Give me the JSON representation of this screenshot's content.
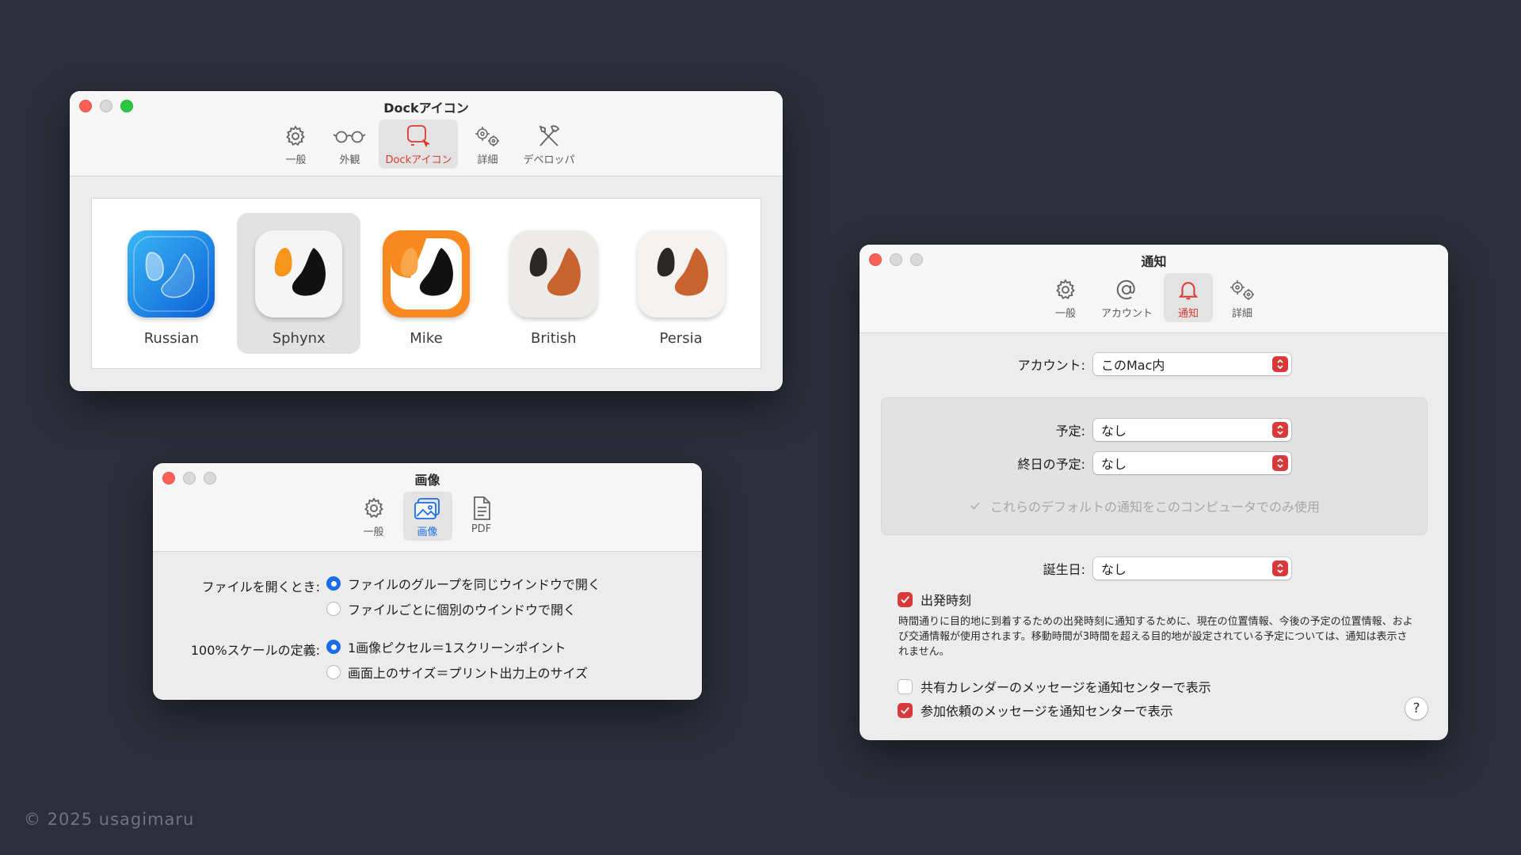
{
  "colors": {
    "background": "#2c2f3b",
    "accent_red": "#d8393a",
    "accent_blue": "#1a6ee8"
  },
  "dock_window": {
    "title": "Dockアイコン",
    "tabs": [
      {
        "label": "一般",
        "icon": "gear-icon"
      },
      {
        "label": "外観",
        "icon": "glasses-icon"
      },
      {
        "label": "Dockアイコン",
        "icon": "dock-icon-icon",
        "active": true
      },
      {
        "label": "詳細",
        "icon": "gears-icon"
      },
      {
        "label": "デベロッパ",
        "icon": "tools-icon"
      }
    ],
    "icons": [
      {
        "label": "Russian"
      },
      {
        "label": "Sphynx",
        "selected": true
      },
      {
        "label": "Mike"
      },
      {
        "label": "British"
      },
      {
        "label": "Persia"
      }
    ]
  },
  "image_window": {
    "title": "画像",
    "tabs": [
      {
        "label": "一般",
        "icon": "gear-icon"
      },
      {
        "label": "画像",
        "icon": "photos-icon",
        "active": true
      },
      {
        "label": "PDF",
        "icon": "document-icon"
      }
    ],
    "open_files": {
      "label": "ファイルを開くとき:",
      "options": [
        "ファイルのグループを同じウインドウで開く",
        "ファイルごとに個別のウインドウで開く"
      ],
      "selected": 0
    },
    "scale": {
      "label": "100%スケールの定義:",
      "options": [
        "1画像ピクセル＝1スクリーンポイント",
        "画面上のサイズ＝プリント出力上のサイズ"
      ],
      "selected": 0
    }
  },
  "notif_window": {
    "title": "通知",
    "tabs": [
      {
        "label": "一般",
        "icon": "gear-icon"
      },
      {
        "label": "アカウント",
        "icon": "at-icon"
      },
      {
        "label": "通知",
        "icon": "bell-icon",
        "active": true
      },
      {
        "label": "詳細",
        "icon": "gears-icon"
      }
    ],
    "account": {
      "label": "アカウント:",
      "value": "このMac内"
    },
    "events": {
      "label": "予定:",
      "value": "なし"
    },
    "all_day": {
      "label": "終日の予定:",
      "value": "なし"
    },
    "default_only": {
      "label": "これらのデフォルトの通知をこのコンピュータでのみ使用",
      "checked": true,
      "disabled": true
    },
    "birthdays": {
      "label": "誕生日:",
      "value": "なし"
    },
    "departure": {
      "label": "出発時刻",
      "checked": true,
      "description": "時間通りに目的地に到着するための出発時刻に通知するために、現在の位置情報、今後の予定の位置情報、および交通情報が使用されます。移動時間が3時間を超える目的地が設定されている予定については、通知は表示されません。"
    },
    "shared_calendar": {
      "label": "共有カレンダーのメッセージを通知センターで表示",
      "checked": false
    },
    "invitations": {
      "label": "参加依頼のメッセージを通知センターで表示",
      "checked": true
    },
    "help_label": "?"
  },
  "copyright": "© 2025 usagimaru"
}
